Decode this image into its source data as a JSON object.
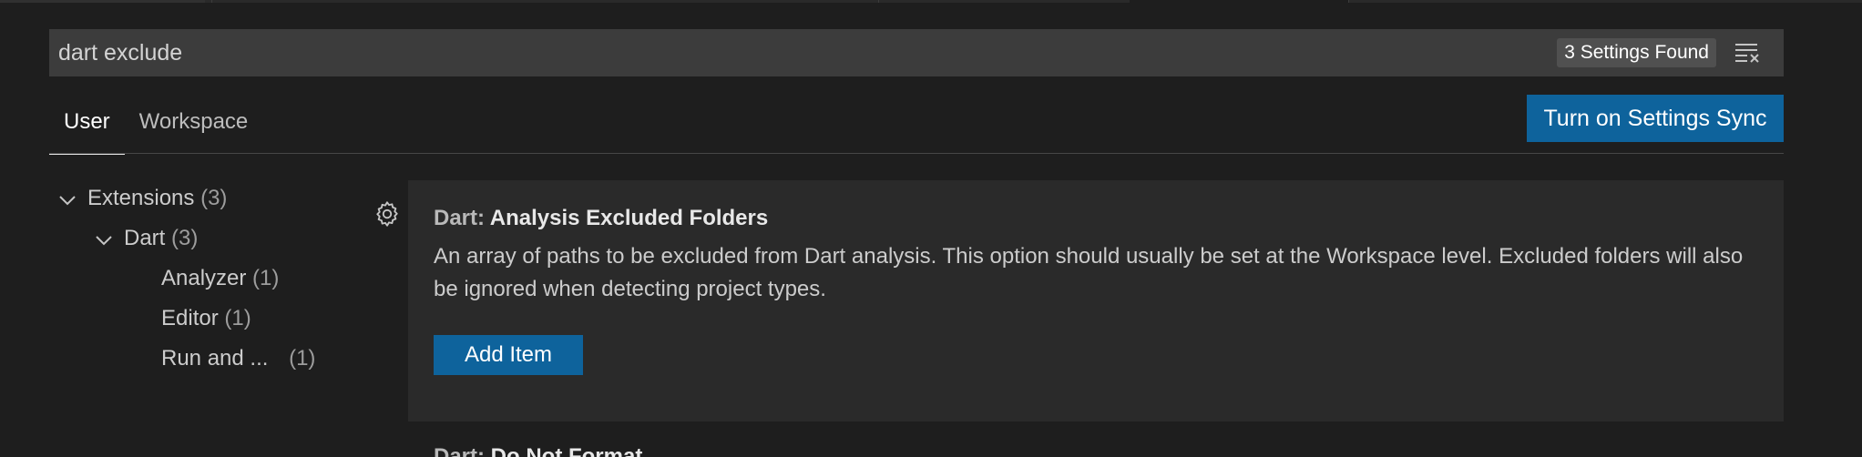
{
  "search": {
    "value": "dart exclude",
    "results_badge": "3 Settings Found",
    "clear_icon": "clear-filter-icon"
  },
  "scope_tabs": [
    {
      "label": "User",
      "active": true
    },
    {
      "label": "Workspace",
      "active": false
    }
  ],
  "sync_button_label": "Turn on Settings Sync",
  "toc": [
    {
      "label": "Extensions",
      "count": "(3)",
      "expanded": true
    },
    {
      "label": "Dart",
      "count": "(3)",
      "expanded": true
    },
    {
      "label": "Analyzer",
      "count": "(1)"
    },
    {
      "label": "Editor",
      "count": "(1)"
    },
    {
      "label": "Run and ...",
      "count": "(1)"
    }
  ],
  "setting": {
    "category": "Dart: ",
    "name": "Analysis Excluded Folders",
    "description": "An array of paths to be excluded from Dart analysis. This option should usually be set at the Workspace level. Excluded folders will also be ignored when detecting project types.",
    "add_item_label": "Add Item",
    "gear_icon": "gear-icon"
  },
  "next_setting": {
    "category": "Dart: ",
    "name": "Do Not Format"
  },
  "colors": {
    "background": "#1e1e1e",
    "input_background": "#3c3c3c",
    "card_background": "#2a2a2a",
    "accent_button": "#0e639c"
  }
}
